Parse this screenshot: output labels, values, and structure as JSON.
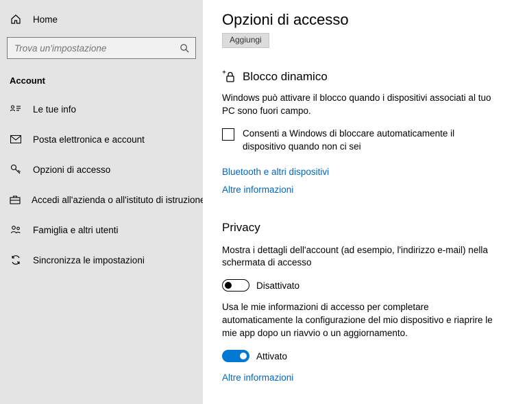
{
  "sidebar": {
    "home": "Home",
    "search_placeholder": "Trova un'impostazione",
    "section": "Account",
    "items": [
      "Le tue info",
      "Posta elettronica e account",
      "Opzioni di accesso",
      "Accedi all'azienda o all'istituto di istruzione",
      "Famiglia e altri utenti",
      "Sincronizza le impostazioni"
    ]
  },
  "page": {
    "title": "Opzioni di accesso",
    "aggiungi": "Aggiungi"
  },
  "dynamic_lock": {
    "heading": "Blocco dinamico",
    "desc": "Windows può attivare il blocco quando i dispositivi associati al tuo PC sono fuori campo.",
    "checkbox_label": "Consenti a Windows di bloccare automaticamente il dispositivo quando non ci sei",
    "link_bt": "Bluetooth e altri dispositivi",
    "link_more": "Altre informazioni"
  },
  "privacy": {
    "heading": "Privacy",
    "show_details_desc": "Mostra i dettagli dell'account (ad esempio, l'indirizzo e-mail) nella schermata di accesso",
    "off": "Disattivato",
    "auto_signin_desc": "Usa le mie informazioni di accesso per completare automaticamente la configurazione del mio dispositivo e riaprire le mie app dopo un riavvio o un aggiornamento.",
    "on": "Attivato",
    "link_more": "Altre informazioni"
  }
}
